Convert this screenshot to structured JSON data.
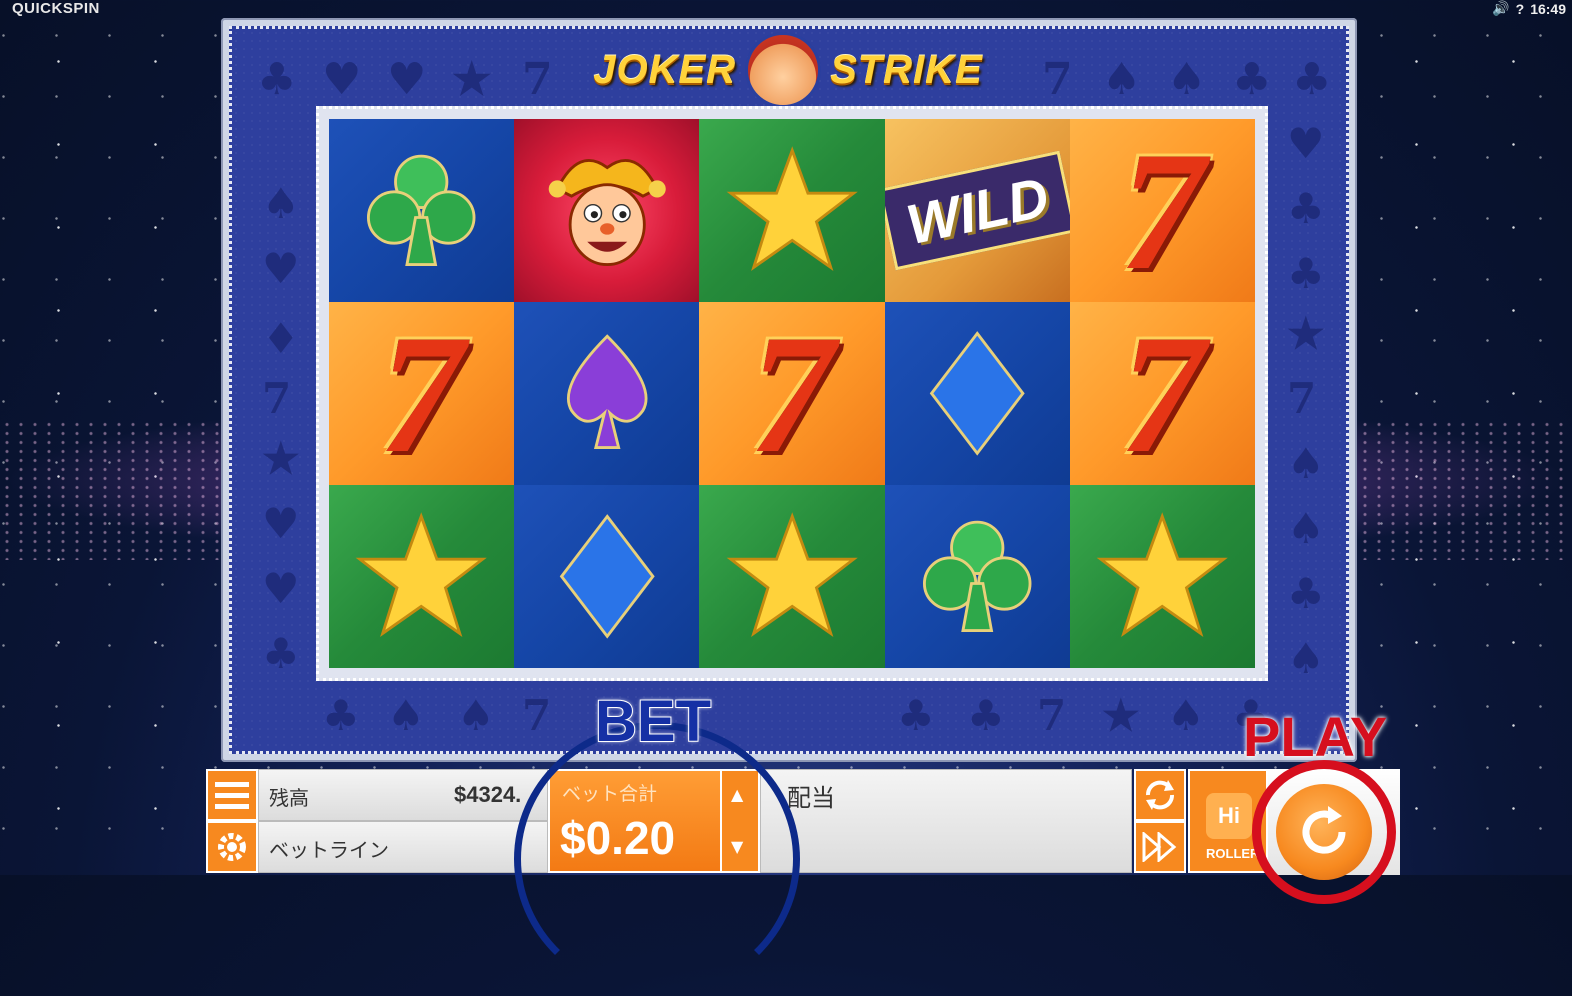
{
  "brand": "QUICKSPIN",
  "status": {
    "sound_icon": "speaker-icon",
    "help": "?",
    "time": "16:49"
  },
  "game": {
    "logo_left": "JOKER",
    "logo_right": "STRIKE"
  },
  "reels": {
    "rows": [
      [
        "club",
        "joker",
        "star",
        "wild",
        "seven"
      ],
      [
        "seven",
        "spade",
        "seven",
        "diamond",
        "seven"
      ],
      [
        "star",
        "diamond",
        "star",
        "club",
        "star"
      ]
    ],
    "wild_label": "WILD",
    "seven_label": "7"
  },
  "bottom_bar": {
    "balance_label": "残高",
    "balance_value": "$4324.",
    "betlines_label": "ベットライン",
    "bet_total_label": "ベット合計",
    "bet_total_value": "$0.20",
    "win_label": "配当",
    "bet_overlay": "BET",
    "play_overlay": "PLAY",
    "hiroller_top": "Hi",
    "hiroller_bottom": "ROLLER"
  },
  "colors": {
    "accent_orange": "#f7891f",
    "play_red": "#d60f1e",
    "bet_blue": "#1530a5"
  }
}
